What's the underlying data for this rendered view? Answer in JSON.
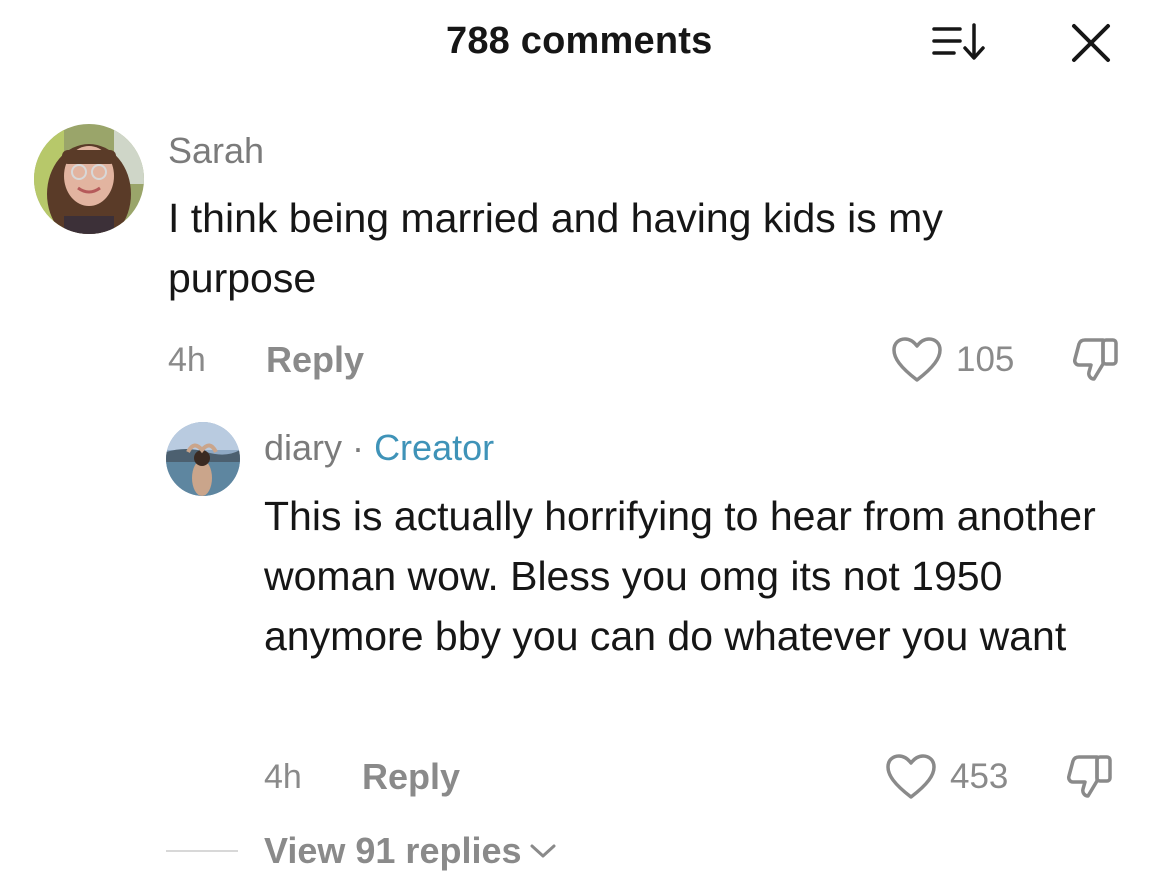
{
  "header": {
    "title": "788 comments",
    "sort_icon": "sort-down-icon",
    "close_icon": "close-icon"
  },
  "comments": [
    {
      "username": "Sarah",
      "text": "I think being married and having kids is my purpose",
      "time": "4h",
      "reply_label": "Reply",
      "likes": "105"
    },
    {
      "username": "diary",
      "separator": "·",
      "badge": "Creator",
      "text": "This is actually horrifying to hear from another woman wow. Bless you omg its not 1950 anymore bby you can do whatever you want",
      "time": "4h",
      "reply_label": "Reply",
      "likes": "453"
    }
  ],
  "view_replies": {
    "label": "View 91 replies"
  },
  "colors": {
    "text": "#161616",
    "muted": "#8a8a8a",
    "creator": "#3f93b8"
  }
}
